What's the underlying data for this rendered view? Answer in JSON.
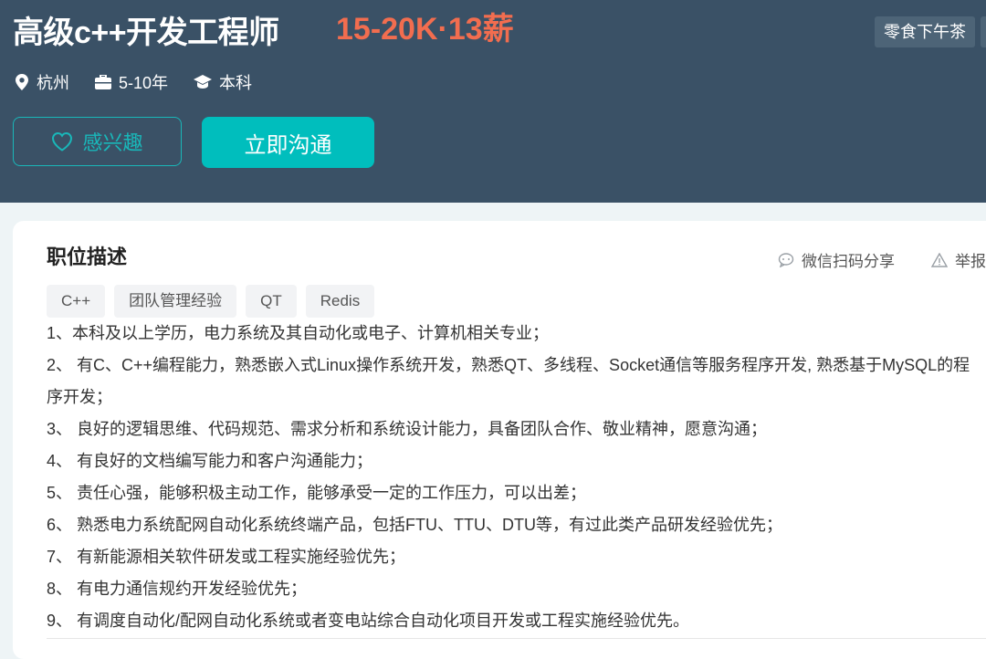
{
  "job": {
    "title": "高级c++开发工程师",
    "salary": "15-20K·13薪",
    "benefits": [
      "零食下午茶"
    ],
    "location": "杭州",
    "experience": "5-10年",
    "education": "本科"
  },
  "actions": {
    "interest_label": "感兴趣",
    "chat_label": "立即沟通"
  },
  "description": {
    "section_title": "职位描述",
    "share_label": "微信扫码分享",
    "report_label": "举报",
    "skill_tags": [
      "C++",
      "团队管理经验",
      "QT",
      "Redis"
    ],
    "lines": [
      "1、本科及以上学历，电力系统及其自动化或电子、计算机相关专业；",
      "2、 有C、C++编程能力，熟悉嵌入式Linux操作系统开发，熟悉QT、多线程、Socket通信等服务程序开发, 熟悉基于MySQL的程序开发；",
      "3、 良好的逻辑思维、代码规范、需求分析和系统设计能力，具备团队合作、敬业精神，愿意沟通；",
      "4、 有良好的文档编写能力和客户沟通能力；",
      "5、 责任心强，能够积极主动工作，能够承受一定的工作压力，可以出差；",
      "6、 熟悉电力系统配网自动化系统终端产品，包括FTU、TTU、DTU等，有过此类产品研发经验优先；",
      "7、 有新能源相关软件研发或工程实施经验优先；",
      "8、 有电力通信规约开发经验优先；",
      "9、 有调度自动化/配网自动化系统或者变电站综合自动化项目开发或工程实施经验优先。"
    ]
  },
  "colors": {
    "header_bg": "#3a5166",
    "salary": "#f26d4f",
    "accent": "#00bebd"
  }
}
